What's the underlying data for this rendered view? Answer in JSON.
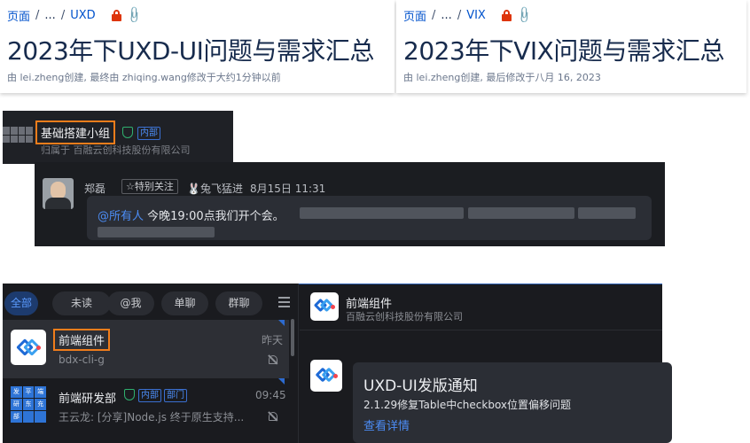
{
  "confluence_left": {
    "breadcrumb": {
      "root": "页面",
      "ellipsis": "...",
      "space": "UXD"
    },
    "title": "2023年下UXD-UI问题与需求汇总",
    "meta": "由 lei.zheng创建, 最终由 zhiqing.wang修改于大约1分钟以前"
  },
  "confluence_right": {
    "breadcrumb": {
      "root": "页面",
      "ellipsis": "...",
      "space": "VIX"
    },
    "title": "2023年下VIX问题与需求汇总",
    "meta": "由 lei.zheng创建, 最后修改于八月 16, 2023"
  },
  "group": {
    "name": "基础搭建小组",
    "tag": "内部",
    "org": "归属于 百融云创科技股份有限公司"
  },
  "message": {
    "sender": "郑磊",
    "special_badge": "☆特别关注",
    "extra": "🐰兔飞猛进",
    "time": "8月15日 11:31",
    "mention": "@所有人",
    "text": "今晚19:00点我们开个会。"
  },
  "im": {
    "filters": [
      "全部",
      "未读",
      "@我",
      "单聊",
      "群聊"
    ],
    "active_filter": "全部",
    "conversations": [
      {
        "name": "前端组件",
        "preview": "bdx-cli-g",
        "time": "昨天"
      },
      {
        "name": "前端研发部",
        "tags": [
          "内部",
          "部门"
        ],
        "preview": "王云龙: [分享]Node.js 终于原生支持...",
        "time": "09:45",
        "tiles": [
          "发",
          "平",
          "端",
          "研",
          "东",
          "充",
          "部",
          "",
          ""
        ]
      }
    ],
    "chat_header": {
      "name": "前端组件",
      "org": "百融云创科技股份有限公司"
    },
    "card": {
      "title": "UXD-UI发版通知",
      "body": "2.1.29修复Table中checkbox位置偏移问题",
      "link": "查看详情"
    }
  },
  "colors": {
    "accent_orange": "#f07d1b",
    "link_blue": "#0052cc",
    "im_blue": "#4c8df6",
    "dark_bg": "#1a1b1f"
  }
}
